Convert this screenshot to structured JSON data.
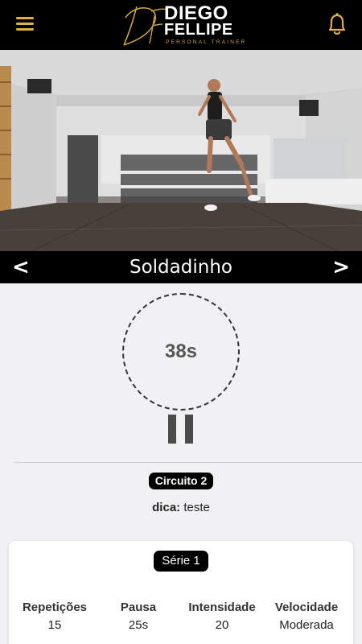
{
  "header": {
    "menu_icon": "hamburger-menu-icon",
    "logo": {
      "line1": "DIEGO",
      "line2": "FELLIPE",
      "tagline": "PERSONAL TRAINER",
      "monogram": "DF"
    },
    "notifications_icon": "bell-icon"
  },
  "exercise": {
    "prev_label": "<",
    "title": "Soldadinho",
    "next_label": ">"
  },
  "timer": {
    "value": "38s",
    "control_icon": "pause-icon"
  },
  "circuit": {
    "label": "Circuito 2",
    "tip_label": "dica:",
    "tip_text": "teste"
  },
  "series": {
    "label": "Série 1",
    "stats": [
      {
        "label": "Repetições",
        "value": "15"
      },
      {
        "label": "Pausa",
        "value": "25s"
      },
      {
        "label": "Intensidade",
        "value": "20"
      },
      {
        "label": "Velocidade",
        "value": "Moderada"
      }
    ]
  },
  "colors": {
    "brand_gold": "#e0b040",
    "header_bg": "#000000",
    "page_bg": "#f1f1f3"
  }
}
